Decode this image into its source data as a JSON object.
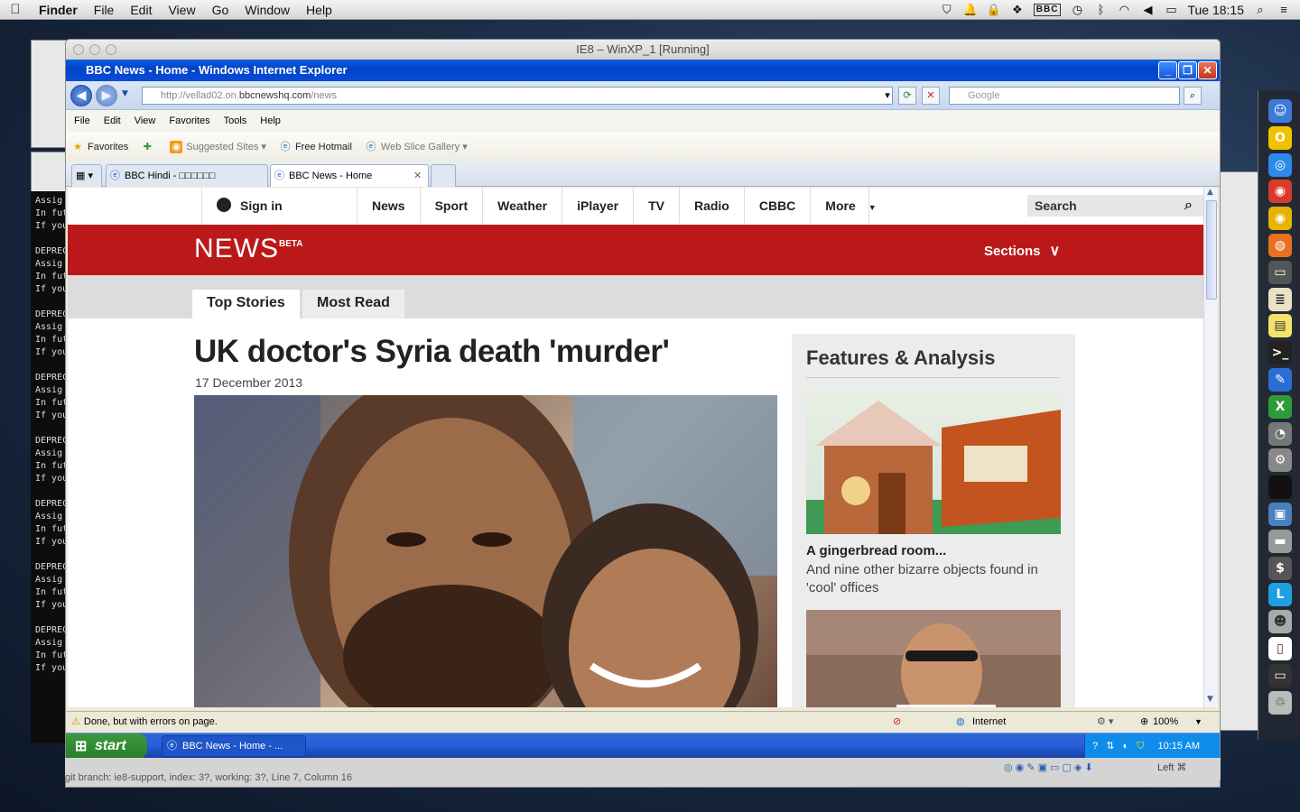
{
  "mac_menubar": {
    "app": "Finder",
    "items": [
      "File",
      "Edit",
      "View",
      "Go",
      "Window",
      "Help"
    ],
    "bbc_badge": "BBC",
    "clock": "Tue 18:15"
  },
  "vbox": {
    "title": "IE8 – WinXP_1 [Running]",
    "bg_status": "git branch: ie8-support, index: 3?, working: 3?, Line 7, Column 16",
    "host_key": "Left ⌘"
  },
  "terminal": {
    "lines": [
      "Assig",
      "In fut",
      "If you",
      "",
      "DEPREC",
      "Assig",
      "In fut",
      "If you",
      "",
      "DEPREC",
      "Assig",
      "In fut",
      "If you",
      "",
      "DEPREC",
      "Assig",
      "In fut",
      "If you",
      "",
      "DEPREC",
      "Assig",
      "In fut",
      "If you",
      "",
      "DEPREC",
      "Assig",
      "In fut",
      "If you",
      "",
      "DEPREC",
      "Assig",
      "In fut",
      "If you",
      "",
      "DEPREC",
      "Assig",
      "In fut",
      "If you"
    ]
  },
  "ie": {
    "title": "BBC News - Home - Windows Internet Explorer",
    "url_prefix": "http://vellad02.on.",
    "url_host": "bbcnewshq.com",
    "url_path": "/news",
    "search_placeholder": "Google",
    "menu": [
      "File",
      "Edit",
      "View",
      "Favorites",
      "Tools",
      "Help"
    ],
    "favorites_label": "Favorites",
    "fav_items": [
      "Suggested Sites",
      "Free Hotmail",
      "Web Slice Gallery"
    ],
    "tabs": [
      "BBC Hindi - □□□□□□",
      "BBC News - Home"
    ],
    "status_text": "Done, but with errors on page.",
    "zone": "Internet",
    "zoom": "100%"
  },
  "bbc": {
    "signin": "Sign in",
    "nav": [
      "News",
      "Sport",
      "Weather",
      "iPlayer",
      "TV",
      "Radio",
      "CBBC",
      "More"
    ],
    "search_label": "Search",
    "logo": "NEWS",
    "beta": "BETA",
    "sections": "Sections",
    "subtabs": [
      "Top Stories",
      "Most Read"
    ],
    "headline": "UK doctor's Syria death 'murder'",
    "date": "17 December 2013",
    "features_title": "Features & Analysis",
    "feature1_title": "A gingerbread room...",
    "feature1_summary": "And nine other bizarre objects found in 'cool' offices"
  },
  "xp_taskbar": {
    "start": "start",
    "task": "BBC News - Home - ...",
    "time": "10:15 AM"
  },
  "colors": {
    "bbc_red": "#bb1919",
    "xp_blue": "#245edb",
    "start_green": "#2a7d2a"
  }
}
